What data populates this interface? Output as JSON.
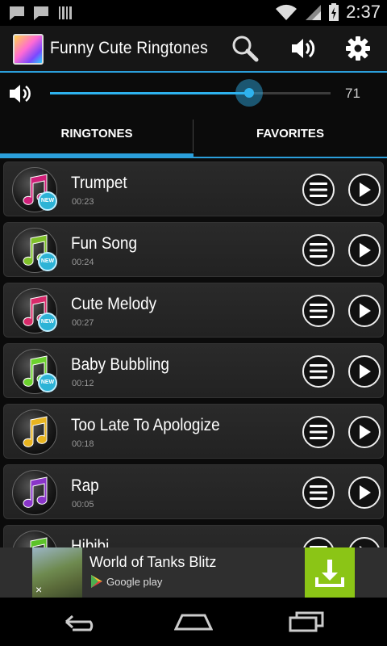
{
  "status_bar": {
    "time": "2:37"
  },
  "app": {
    "title": "Funny Cute Ringtones"
  },
  "volume": {
    "value": 71,
    "value_label": "71"
  },
  "tabs": [
    {
      "label": "RINGTONES",
      "selected": true
    },
    {
      "label": "FAVORITES",
      "selected": false
    }
  ],
  "ringtones": [
    {
      "title": "Trumpet",
      "duration": "00:23",
      "is_new": true,
      "note_color": "#d0207a"
    },
    {
      "title": "Fun Song",
      "duration": "00:24",
      "is_new": true,
      "note_color": "#7fc02a"
    },
    {
      "title": "Cute Melody",
      "duration": "00:27",
      "is_new": true,
      "note_color": "#d82a6a"
    },
    {
      "title": "Baby Bubbling",
      "duration": "00:12",
      "is_new": true,
      "note_color": "#6cd12e"
    },
    {
      "title": "Too Late To Apologize",
      "duration": "00:18",
      "is_new": false,
      "note_color": "#e8b420"
    },
    {
      "title": "Rap",
      "duration": "00:05",
      "is_new": false,
      "note_color": "#8a35c9"
    },
    {
      "title": "Hibibi",
      "duration": "",
      "is_new": false,
      "note_color": "#5cc22a"
    }
  ],
  "badge_label": "NEW",
  "ad": {
    "title": "World of Tanks Blitz",
    "store": "Google play",
    "close_glyph": "×"
  },
  "colors": {
    "accent": "#2b9fdb",
    "download": "#8bc516"
  }
}
